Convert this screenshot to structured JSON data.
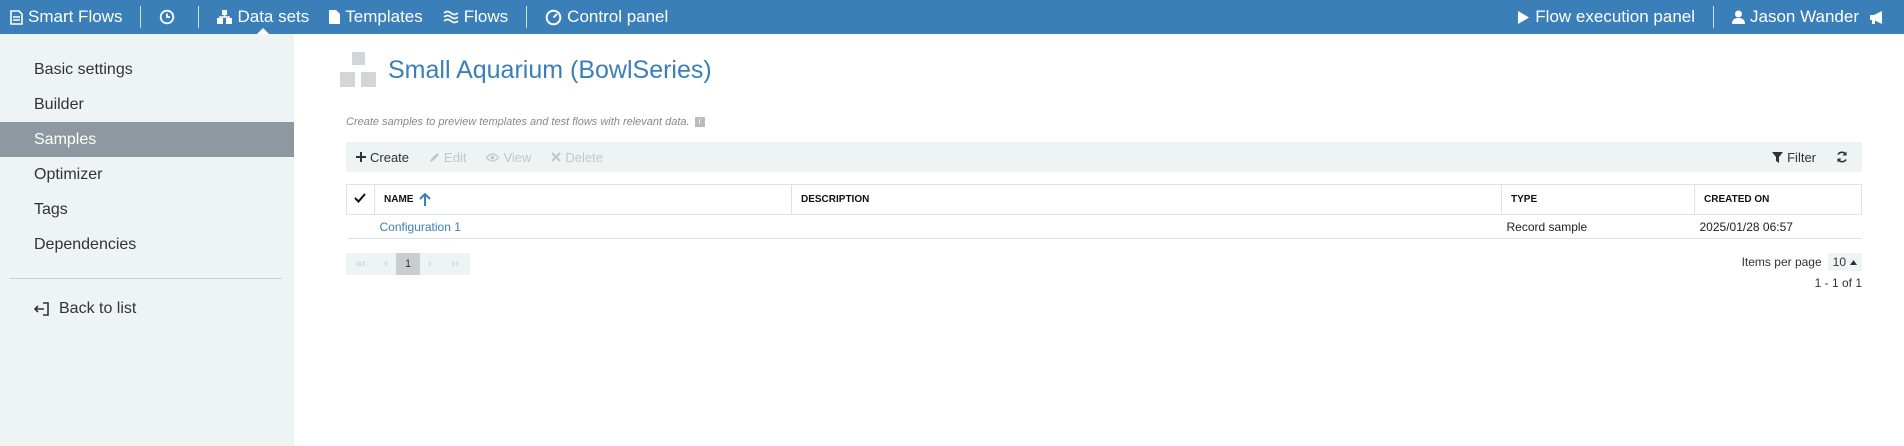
{
  "topbar": {
    "app_name": "Smart Flows",
    "nav": {
      "datasets": "Data sets",
      "templates": "Templates",
      "flows": "Flows",
      "control_panel": "Control panel"
    },
    "flow_execution_panel": "Flow execution panel",
    "user_name": "Jason Wander"
  },
  "sidebar": {
    "items": [
      {
        "label": "Basic settings"
      },
      {
        "label": "Builder"
      },
      {
        "label": "Samples"
      },
      {
        "label": "Optimizer"
      },
      {
        "label": "Tags"
      },
      {
        "label": "Dependencies"
      }
    ],
    "active_index": 2,
    "back_label": "Back to list"
  },
  "page": {
    "title": "Small Aquarium (BowlSeries)",
    "hint": "Create samples to preview templates and test flows with relevant data."
  },
  "toolbar": {
    "create": "Create",
    "edit": "Edit",
    "view": "View",
    "delete": "Delete",
    "filter": "Filter"
  },
  "table": {
    "columns": [
      "NAME",
      "DESCRIPTION",
      "TYPE",
      "CREATED ON"
    ],
    "sort_column": "NAME",
    "rows": [
      {
        "name": "Configuration 1",
        "description": "",
        "type": "Record sample",
        "created_on": "2025/01/28 06:57"
      }
    ]
  },
  "pagination": {
    "first": "«‹",
    "prev": "‹",
    "current": "1",
    "next": "›",
    "last": "››",
    "items_per_page_label": "Items per page",
    "items_per_page": "10",
    "range": "1 - 1 of 1"
  },
  "colors": {
    "accent": "#3a7fb7",
    "sidebar_bg": "#eef3f3",
    "sidebar_active": "#8d98a1"
  }
}
